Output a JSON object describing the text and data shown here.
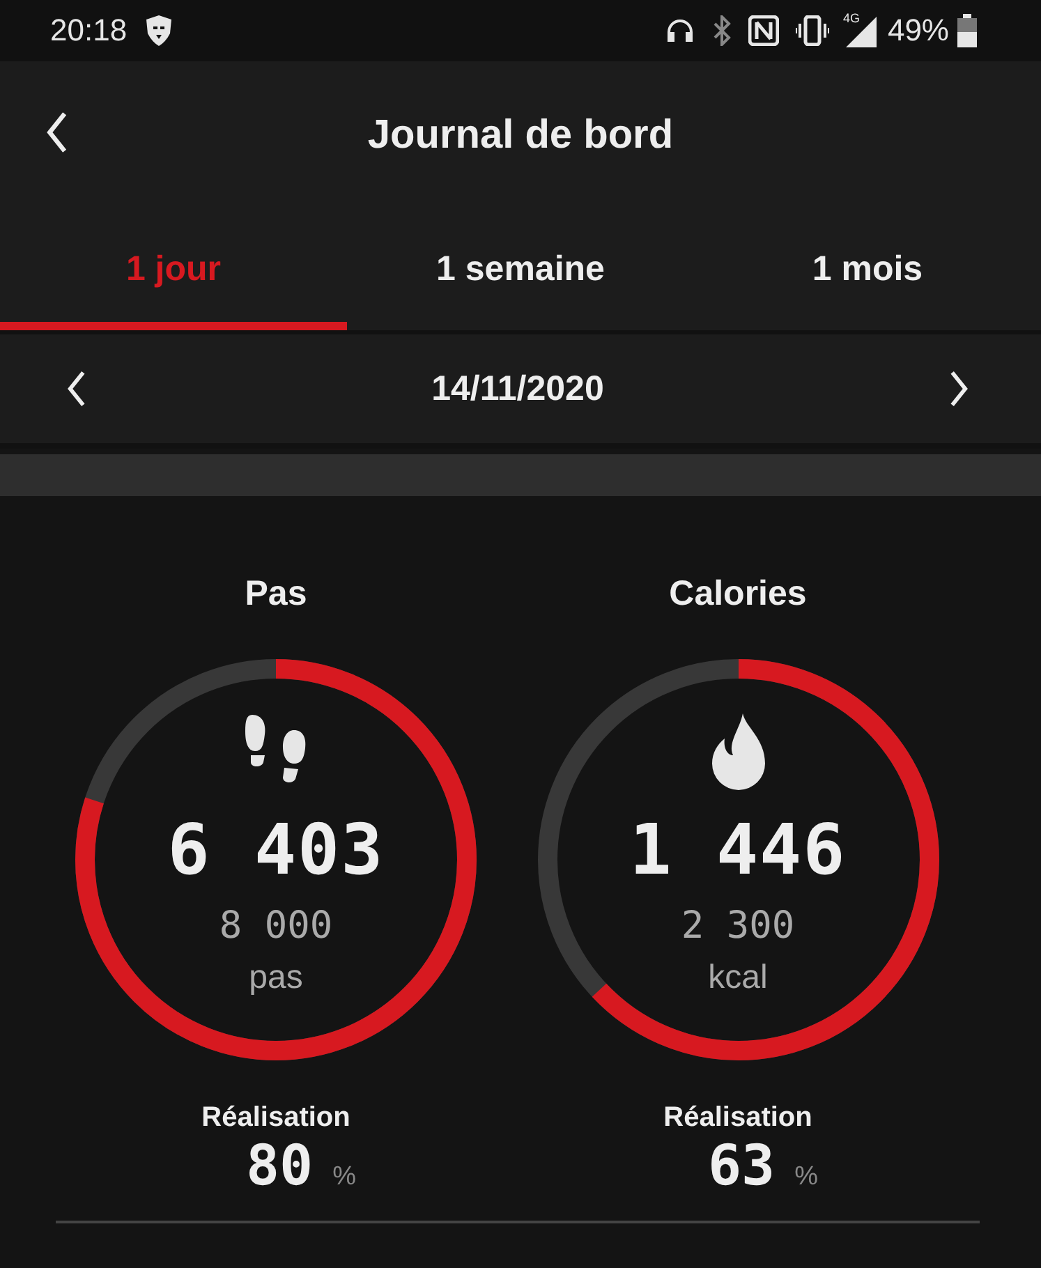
{
  "status_bar": {
    "time": "20:18",
    "network_label": "4G",
    "battery": "49%"
  },
  "header": {
    "title": "Journal de bord"
  },
  "tabs": [
    {
      "label": "1 jour",
      "selected": true
    },
    {
      "label": "1 semaine",
      "selected": false
    },
    {
      "label": "1 mois",
      "selected": false
    }
  ],
  "date_nav": {
    "date": "14/11/2020"
  },
  "metrics": [
    {
      "kind": "steps",
      "title": "Pas",
      "value": "6 403",
      "goal": "8 000",
      "unit": "pas",
      "level": 0.8,
      "achievement_label": "Réalisation",
      "achievement": "80",
      "percent_sign": "%"
    },
    {
      "kind": "calories",
      "title": "Calories",
      "value": "1 446",
      "goal": "2 300",
      "unit": "kcal",
      "level": 0.63,
      "achievement_label": "Réalisation",
      "achievement": "63",
      "percent_sign": "%"
    }
  ]
}
